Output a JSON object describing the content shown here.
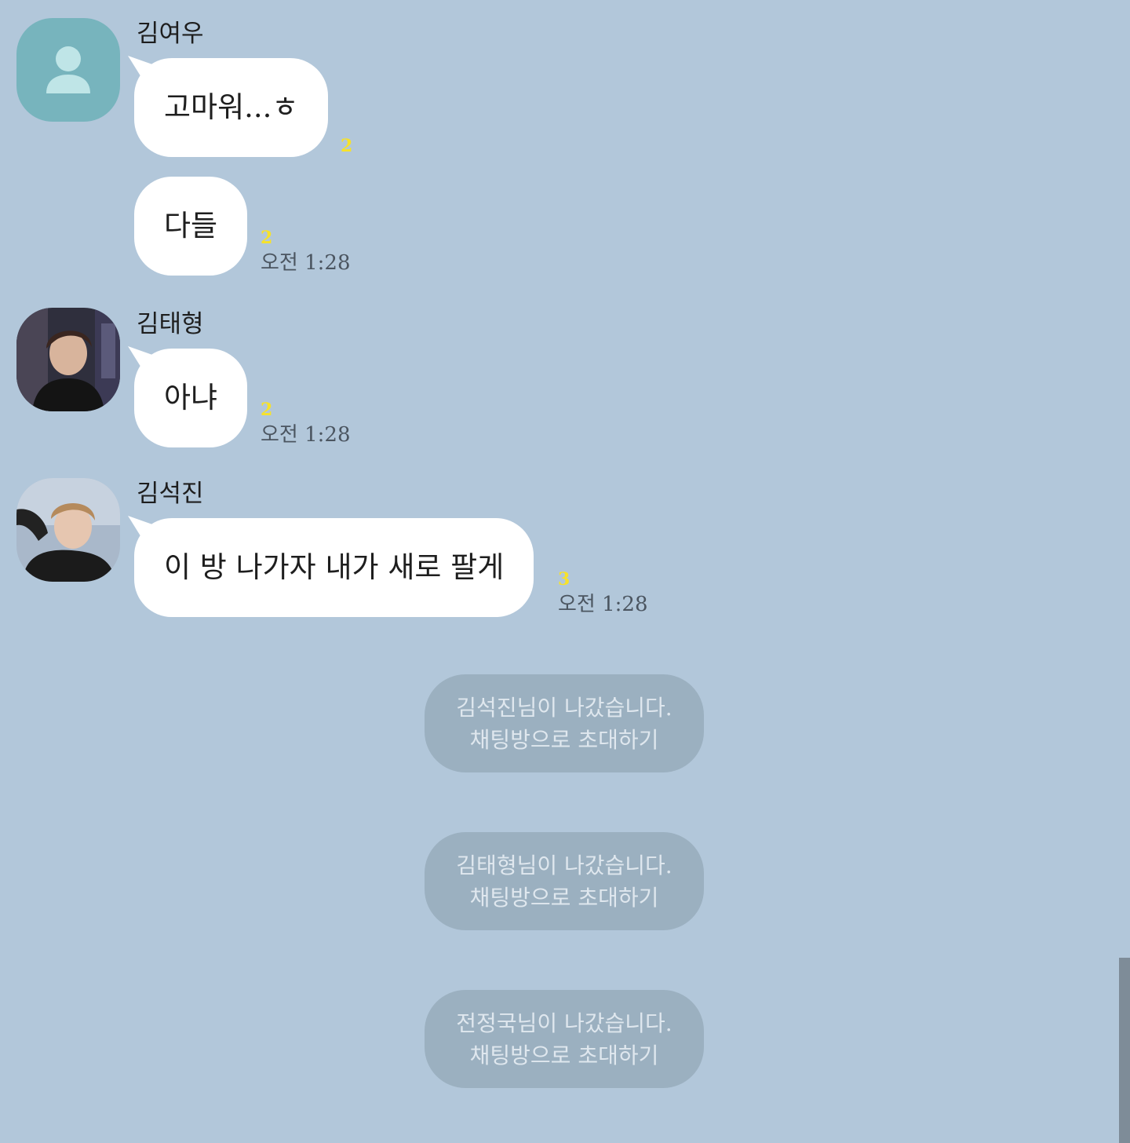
{
  "messages": [
    {
      "sender": "김여우",
      "avatar": "default-profile-icon",
      "bubbles": [
        {
          "text": "고마워...ㅎ",
          "unread": "2"
        },
        {
          "text": "다들",
          "unread": "2",
          "time": "오전 1:28"
        }
      ]
    },
    {
      "sender": "김태형",
      "avatar": "profile-photo-kimtaehyung",
      "bubbles": [
        {
          "text": "아냐",
          "unread": "2",
          "time": "오전 1:28"
        }
      ]
    },
    {
      "sender": "김석진",
      "avatar": "profile-photo-kimseokjin",
      "bubbles": [
        {
          "text": "이 방 나가자 내가 새로 팔게",
          "unread": "3",
          "time": "오전 1:28"
        }
      ]
    }
  ],
  "notices": [
    {
      "text": "김석진님이 나갔습니다.",
      "action": "채팅방으로 초대하기"
    },
    {
      "text": "김태형님이 나갔습니다.",
      "action": "채팅방으로 초대하기"
    },
    {
      "text": "전정국님이 나갔습니다.",
      "action": "채팅방으로 초대하기"
    }
  ],
  "colors": {
    "background": "#b2c7da",
    "bubble": "#ffffff",
    "unread": "#f7e22a",
    "notice_bg": "#9bb0c0",
    "notice_text": "#dfe7ee",
    "default_avatar": "#77b4bd"
  }
}
